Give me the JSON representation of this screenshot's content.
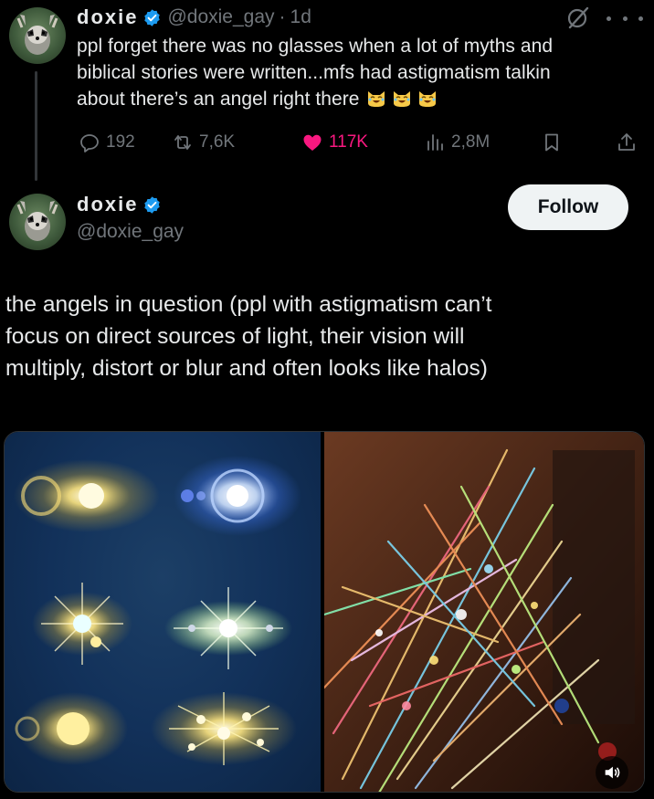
{
  "reply_tweet": {
    "display_name": "doxie",
    "handle": "@doxie_gay",
    "separator": "·",
    "time": "1d",
    "text_lines": [
      "ppl forget there was no glasses when a lot of myths and",
      "biblical stories were written...mfs had astigmatism talkin",
      "about there’s an angel right there"
    ],
    "emojis": [
      "laughing-cat-emoji",
      "laughing-cat-emoji",
      "laughing-cat-emoji"
    ],
    "stats": {
      "replies": "192",
      "reposts": "7,6K",
      "likes": "117K",
      "views": "2,8M"
    }
  },
  "main_tweet": {
    "display_name": "doxie",
    "handle": "@doxie_gay",
    "follow_label": "Follow",
    "text_lines": [
      "the angels in question (ppl with astigmatism can’t",
      "focus on direct sources of light, their vision will",
      "multiply, distort or blur and often looks like halos)"
    ],
    "media": [
      {
        "name": "lens-flare-halos-image"
      },
      {
        "name": "christmas-lights-streaks-image"
      }
    ]
  },
  "colors": {
    "background": "#000000",
    "text": "#e7e9ea",
    "muted": "#71767b",
    "verified": "#1d9bf0",
    "like": "#f91880",
    "follow_bg": "#eff3f4"
  }
}
